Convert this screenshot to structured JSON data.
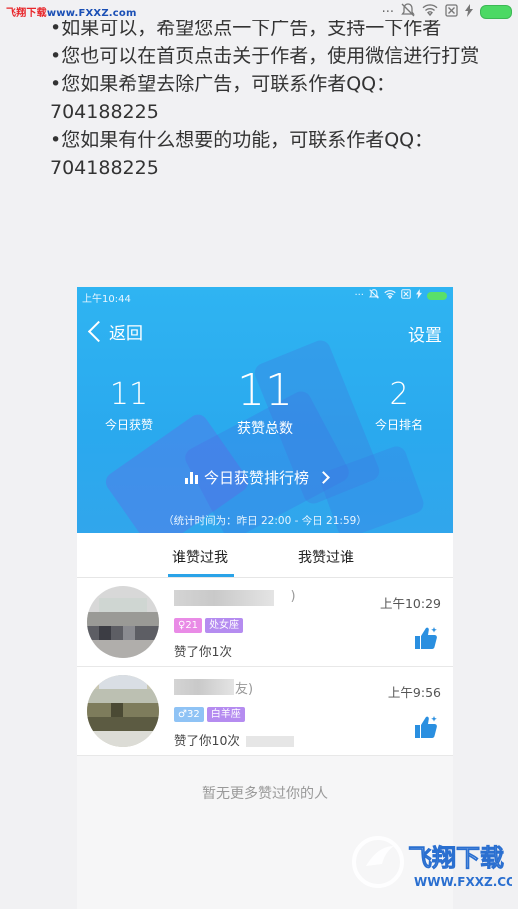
{
  "watermark_top": {
    "left": "飞翔下载",
    "right": "www.FXXZ.com"
  },
  "outer_status": {
    "signal_glyph": "···"
  },
  "intro_lines": [
    "•如果可以，希望您点一下广告，支持一下作者",
    "•您也可以在首页点击关于作者，使用微信进行打赏",
    "•您如果希望去除广告，可联系作者QQ：704188225",
    "•您如果有什么想要的功能，可联系作者QQ：704188225"
  ],
  "inner_status": {
    "time": "上午10:44"
  },
  "header": {
    "back_label": "返回",
    "settings_label": "设置"
  },
  "stats": {
    "today_likes": {
      "value": "11",
      "label": "今日获赞"
    },
    "total_likes": {
      "value": "11",
      "label": "获赞总数"
    },
    "today_rank": {
      "value": "2",
      "label": "今日排名"
    }
  },
  "rank_link_label": "今日获赞排行榜",
  "stat_note": "（统计时间为：昨日 22:00 - 今日 21:59）",
  "tabs": [
    {
      "label": "谁赞过我",
      "active": true
    },
    {
      "label": "我赞过谁",
      "active": false
    }
  ],
  "likes": [
    {
      "name_suffix": "    )",
      "gender_badge": "♀21",
      "zodiac": "处女座",
      "liked_text": "赞了你1次",
      "time": "上午10:29",
      "badge_color": "#e98be6"
    },
    {
      "name_suffix": "友)",
      "gender_badge": "♂32",
      "zodiac": "白羊座",
      "liked_text": "赞了你10次",
      "time": "上午9:56",
      "badge_color": "#8fc3f5"
    }
  ],
  "empty_message": "暂无更多赞过你的人",
  "watermark_bottom": {
    "brand": "飞翔下载",
    "url": "WWW.FXXZ.COM"
  },
  "colors": {
    "accent": "#2aa3e8",
    "hero": "#2fb4f2",
    "zodiac_badge": "#b58cf0",
    "thumb": "#2a8fe0"
  }
}
